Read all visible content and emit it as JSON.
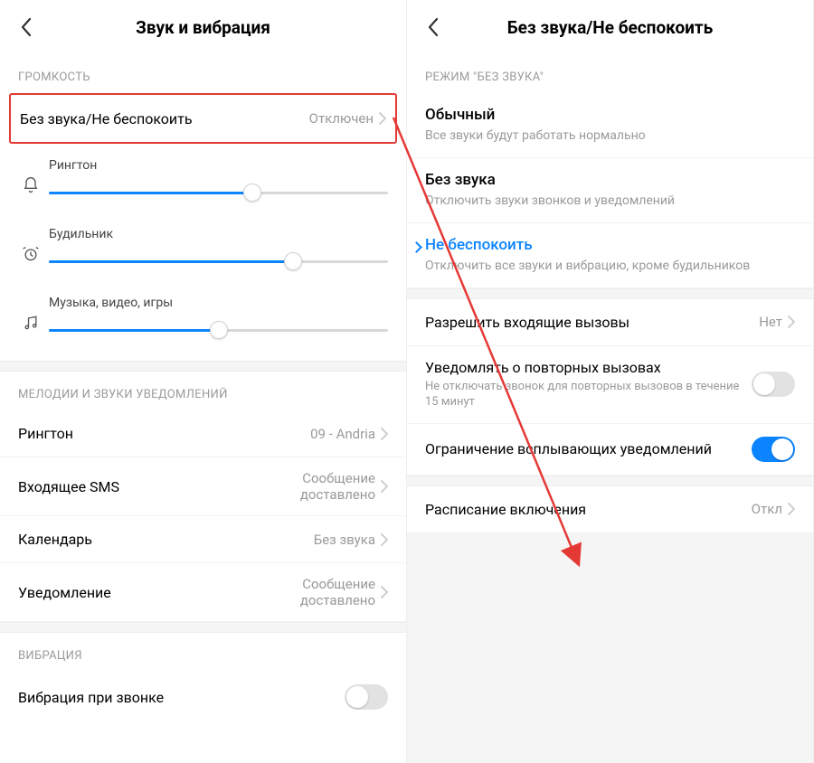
{
  "left": {
    "title": "Звук и вибрация",
    "sections": {
      "volume": "ГРОМКОСТЬ",
      "ringtones": "МЕЛОДИИ И ЗВУКИ УВЕДОМЛЕНИЙ",
      "vibration": "ВИБРАЦИЯ"
    },
    "silent_row": {
      "label": "Без звука/Не беспокоить",
      "value": "Отключен"
    },
    "sliders": {
      "ringtone": {
        "label": "Рингтон",
        "pct": 60
      },
      "alarm": {
        "label": "Будильник",
        "pct": 72
      },
      "media": {
        "label": "Музыка, видео, игры",
        "pct": 50
      }
    },
    "ringtones": {
      "ringtone": {
        "label": "Рингтон",
        "value": "09 - Andria"
      },
      "sms": {
        "label": "Входящее SMS",
        "value": "Сообщение доставлено"
      },
      "calendar": {
        "label": "Календарь",
        "value": "Без звука"
      },
      "notif": {
        "label": "Уведомление",
        "value": "Сообщение доставлено"
      }
    },
    "vibration_row": {
      "label": "Вибрация при звонке",
      "on": false
    }
  },
  "right": {
    "title": "Без звука/Не беспокоить",
    "section_mode": "РЕЖИМ \"БЕЗ ЗВУКА\"",
    "modes": {
      "normal": {
        "title": "Обычный",
        "sub": "Все звуки будут работать нормально"
      },
      "silent": {
        "title": "Без звука",
        "sub": "Отключить звуки звонков и уведомлений"
      },
      "dnd": {
        "title": "Не беспокоить",
        "sub": "Отключить все звуки и вибрацию, кроме будильников"
      }
    },
    "allow_calls": {
      "label": "Разрешить входящие вызовы",
      "value": "Нет"
    },
    "repeated": {
      "title": "Уведомлять о повторных вызовах",
      "sub": "Не отключать звонок для повторных вызовов в течение 15 минут",
      "on": false
    },
    "popup": {
      "title": "Ограничение всплывающих уведомлений",
      "on": true
    },
    "schedule": {
      "label": "Расписание включения",
      "value": "Откл"
    }
  }
}
